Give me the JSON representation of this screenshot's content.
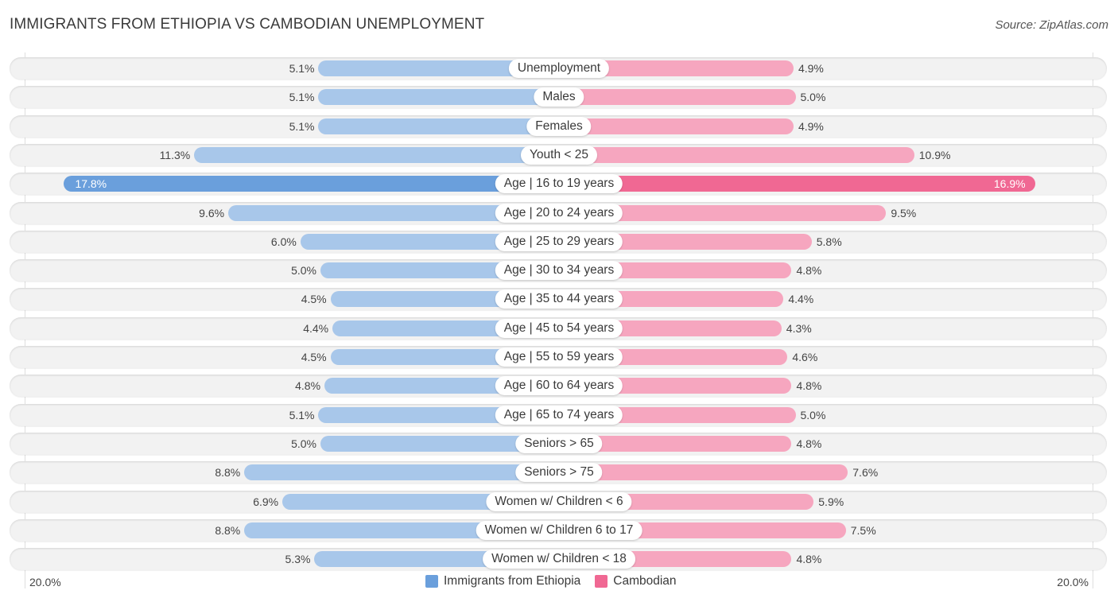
{
  "header": {
    "title": "IMMIGRANTS FROM ETHIOPIA VS CAMBODIAN UNEMPLOYMENT",
    "source": "Source: ZipAtlas.com"
  },
  "colors": {
    "left": "#a8c7ea",
    "left_highlight": "#6a9fdc",
    "right": "#f6a6bf",
    "right_highlight": "#f06893",
    "legend_left": "#6a9fdc",
    "legend_right": "#f06893"
  },
  "chart_data": {
    "type": "bar",
    "orientation": "diverging-horizontal",
    "title": "IMMIGRANTS FROM ETHIOPIA VS CAMBODIAN UNEMPLOYMENT",
    "xlabel": "",
    "ylabel": "",
    "xlim": [
      -20.0,
      20.0
    ],
    "axis_ticks": {
      "left": "20.0%",
      "right": "20.0%"
    },
    "legend_position": "bottom-center",
    "grid": false,
    "categories": [
      "Unemployment",
      "Males",
      "Females",
      "Youth < 25",
      "Age | 16 to 19 years",
      "Age | 20 to 24 years",
      "Age | 25 to 29 years",
      "Age | 30 to 34 years",
      "Age | 35 to 44 years",
      "Age | 45 to 54 years",
      "Age | 55 to 59 years",
      "Age | 60 to 64 years",
      "Age | 65 to 74 years",
      "Seniors > 65",
      "Seniors > 75",
      "Women w/ Children < 6",
      "Women w/ Children 6 to 17",
      "Women w/ Children < 18"
    ],
    "series": [
      {
        "name": "Immigrants from Ethiopia",
        "side": "left",
        "values": [
          5.1,
          5.1,
          5.1,
          11.3,
          17.8,
          9.6,
          6.0,
          5.0,
          4.5,
          4.4,
          4.5,
          4.8,
          5.1,
          5.0,
          8.8,
          6.9,
          8.8,
          5.3
        ],
        "labels": [
          "5.1%",
          "5.1%",
          "5.1%",
          "11.3%",
          "17.8%",
          "9.6%",
          "6.0%",
          "5.0%",
          "4.5%",
          "4.4%",
          "4.5%",
          "4.8%",
          "5.1%",
          "5.0%",
          "8.8%",
          "6.9%",
          "8.8%",
          "5.3%"
        ]
      },
      {
        "name": "Cambodian",
        "side": "right",
        "values": [
          4.9,
          5.0,
          4.9,
          10.9,
          16.9,
          9.5,
          5.8,
          4.8,
          4.4,
          4.3,
          4.6,
          4.8,
          5.0,
          4.8,
          7.6,
          5.9,
          7.5,
          4.8
        ],
        "labels": [
          "4.9%",
          "5.0%",
          "4.9%",
          "10.9%",
          "16.9%",
          "9.5%",
          "5.8%",
          "4.8%",
          "4.4%",
          "4.3%",
          "4.6%",
          "4.8%",
          "5.0%",
          "4.8%",
          "7.6%",
          "5.9%",
          "7.5%",
          "4.8%"
        ]
      }
    ],
    "highlighted_category": "Age | 16 to 19 years"
  },
  "legend": {
    "items": [
      {
        "label": "Immigrants from Ethiopia"
      },
      {
        "label": "Cambodian"
      }
    ]
  }
}
